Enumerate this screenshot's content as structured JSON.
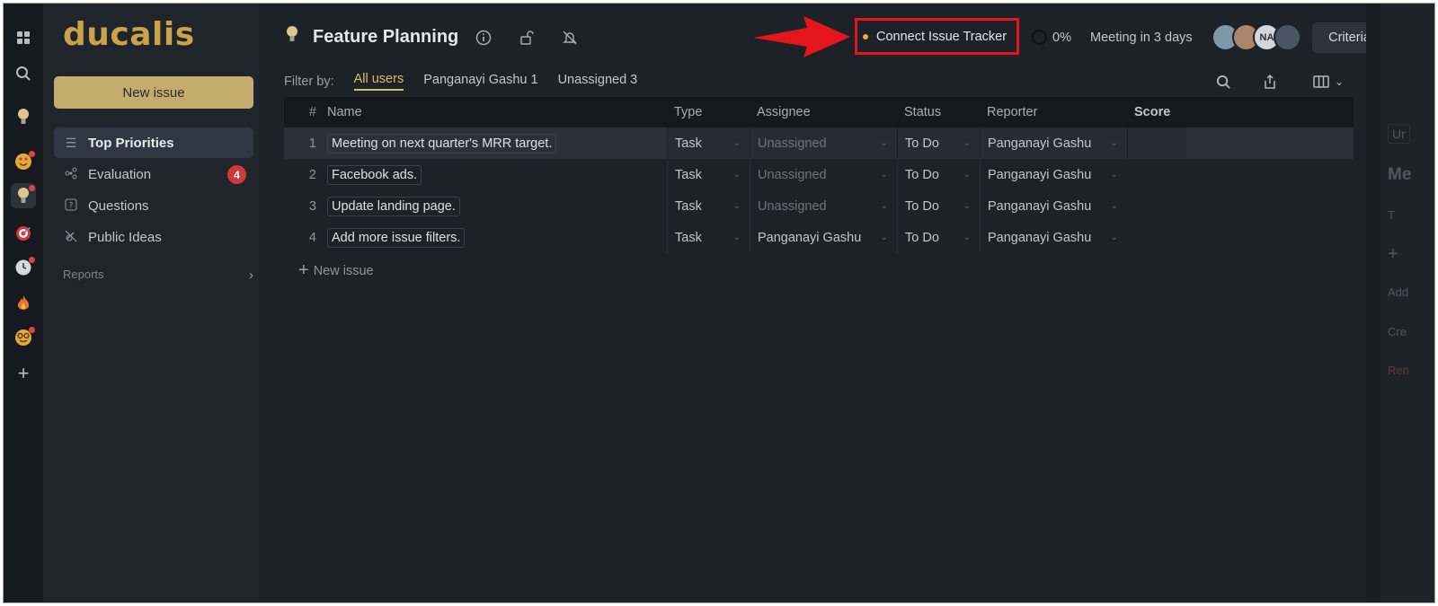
{
  "logo": "ducalis",
  "rail": {
    "icons": [
      "grid-icon",
      "search-icon",
      "bulb-icon",
      "heart-eyes-icon",
      "bulb-icon",
      "target-icon",
      "clock-icon",
      "fire-icon",
      "nerd-face-icon",
      "plus-icon"
    ]
  },
  "sidebar": {
    "new_issue_label": "New issue",
    "items": [
      {
        "label": "Top Priorities",
        "icon": "list-icon"
      },
      {
        "label": "Evaluation",
        "icon": "nodes-icon",
        "badge": "4"
      },
      {
        "label": "Questions",
        "icon": "question-card-icon"
      },
      {
        "label": "Public Ideas",
        "icon": "broadcast-off-icon"
      }
    ],
    "reports_label": "Reports"
  },
  "header": {
    "title": "Feature Planning",
    "connect_label": "Connect Issue Tracker",
    "progress": "0%",
    "meeting": "Meeting in 3 days",
    "avatar_initials": "NA",
    "criteria_label": "Criteria"
  },
  "filter": {
    "label": "Filter by:",
    "options": [
      "All users",
      "Panganayi Gashu 1",
      "Unassigned 3"
    ]
  },
  "table": {
    "columns": [
      "#",
      "Name",
      "Type",
      "Assignee",
      "Status",
      "Reporter",
      "Score"
    ],
    "rows": [
      {
        "num": "1",
        "name": "Meeting on next quarter's MRR target.",
        "type": "Task",
        "assignee": "Unassigned",
        "status": "To Do",
        "reporter": "Panganayi Gashu"
      },
      {
        "num": "2",
        "name": "Facebook ads.",
        "type": "Task",
        "assignee": "Unassigned",
        "status": "To Do",
        "reporter": "Panganayi Gashu"
      },
      {
        "num": "3",
        "name": "Update landing page.",
        "type": "Task",
        "assignee": "Unassigned",
        "status": "To Do",
        "reporter": "Panganayi Gashu"
      },
      {
        "num": "4",
        "name": "Add more issue filters.",
        "type": "Task",
        "assignee": "Panganayi Gashu",
        "status": "To Do",
        "reporter": "Panganayi Gashu"
      }
    ],
    "new_issue_label": "New issue"
  },
  "right_panel": {
    "fragments": [
      "Ur",
      "Me",
      "T",
      "+",
      "Add",
      "Cre",
      "Ren"
    ]
  },
  "colors": {
    "accent": "#c9a24a",
    "highlight_box": "#e5161b",
    "badge": "#d1383c"
  }
}
